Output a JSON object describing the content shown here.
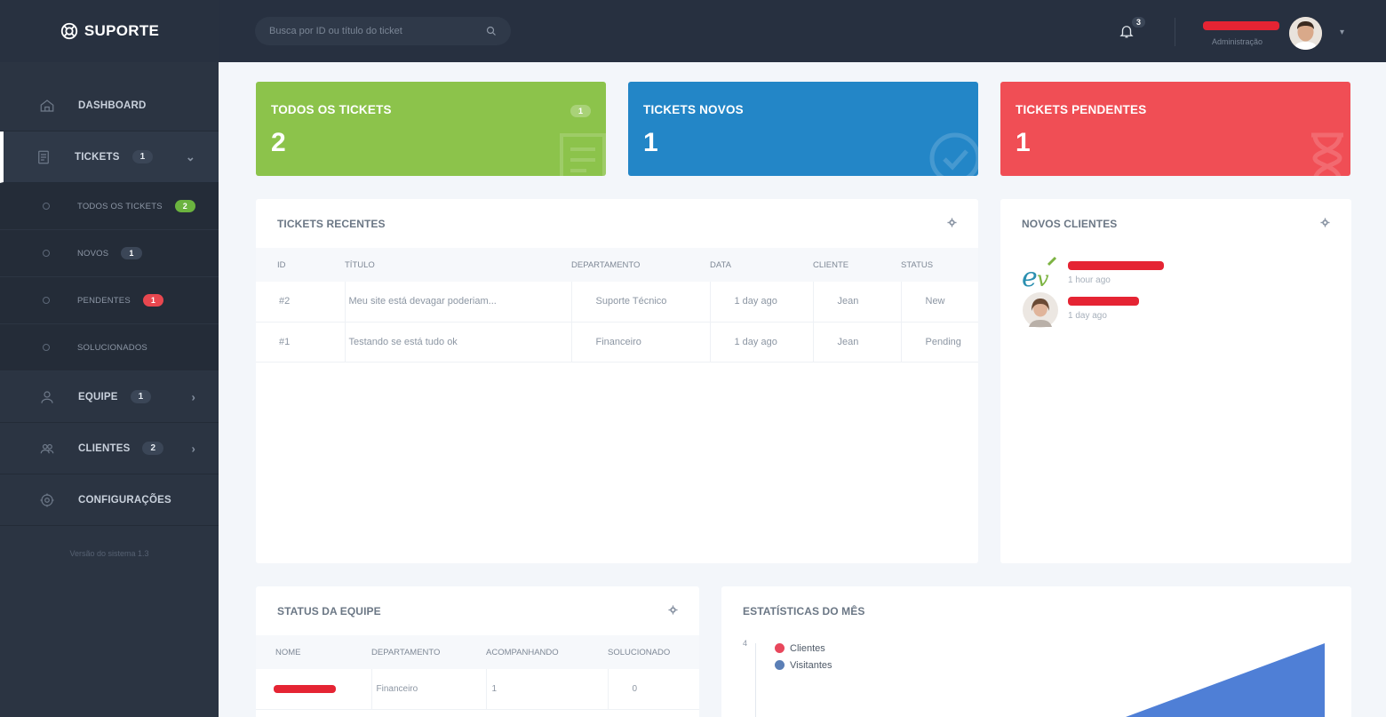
{
  "brand": {
    "name": "SUPORTE"
  },
  "colors": {
    "sidebar": "#2b3442",
    "topbar": "#273040",
    "green": "#8cc34b",
    "blue": "#2386c7",
    "red": "#f04e55"
  },
  "sidebar": {
    "items": [
      {
        "label": "DASHBOARD",
        "icon": "home-icon"
      },
      {
        "label": "TICKETS",
        "count": "1",
        "icon": "ticket-icon"
      },
      {
        "label": "EQUIPE",
        "count": "1",
        "icon": "user-icon"
      },
      {
        "label": "CLIENTES",
        "count": "2",
        "icon": "users-icon"
      },
      {
        "label": "CONFIGURAÇÕES",
        "icon": "gear-icon"
      }
    ],
    "sub_items": [
      {
        "label": "TODOS OS TICKETS",
        "badge": "2"
      },
      {
        "label": "NOVOS",
        "badge": "1"
      },
      {
        "label": "PENDENTES",
        "badge": "1"
      },
      {
        "label": "SOLUCIONADOS"
      }
    ],
    "version": "Versão do sistema 1.3"
  },
  "topbar": {
    "search_placeholder": "Busca por ID ou título do ticket",
    "notifications": "3",
    "user_role": "Administração"
  },
  "stats": [
    {
      "label": "TODOS OS TICKETS",
      "value": "2",
      "mini": "1"
    },
    {
      "label": "TICKETS NOVOS",
      "value": "1"
    },
    {
      "label": "TICKETS PENDENTES",
      "value": "1"
    }
  ],
  "recent": {
    "title": "TICKETS RECENTES",
    "columns": [
      "ID",
      "TÍTULO",
      "DEPARTAMENTO",
      "DATA",
      "CLIENTE",
      "STATUS"
    ],
    "rows": [
      {
        "id": "#2",
        "title": "Meu site está devagar poderiam...",
        "dept": "Suporte Técnico",
        "date": "1 day ago",
        "client": "Jean",
        "status": "New"
      },
      {
        "id": "#1",
        "title": "Testando se está tudo ok",
        "dept": "Financeiro",
        "date": "1 day ago",
        "client": "Jean",
        "status": "Pending"
      }
    ]
  },
  "clients": {
    "title": "NOVOS CLIENTES",
    "items": [
      {
        "time": "1 hour ago"
      },
      {
        "time": "1 day ago"
      }
    ]
  },
  "team": {
    "title": "STATUS DA EQUIPE",
    "columns": [
      "NOME",
      "DEPARTAMENTO",
      "ACOMPANHANDO",
      "SOLUCIONADO"
    ],
    "rows": [
      {
        "dept": "Financeiro",
        "following": "1",
        "solved": "0"
      }
    ]
  },
  "month": {
    "title": "ESTATÍSTICAS DO MÊS",
    "legend": [
      "Clientes",
      "Visitantes"
    ],
    "legend_colors": [
      "#e8475c",
      "#5b7fb6"
    ],
    "y_tick": "4"
  }
}
